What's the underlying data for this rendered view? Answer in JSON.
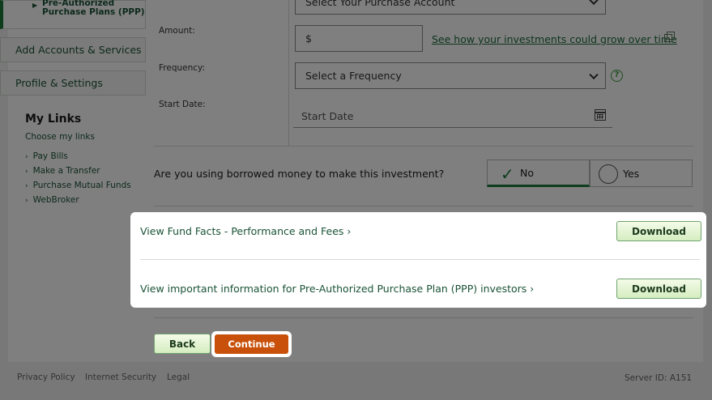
{
  "sidebar": {
    "ppp_item_line1": "Pre-Authorized",
    "ppp_item_line2": "Purchase Plans (PPP)",
    "add_accounts": "Add Accounts & Services",
    "profile_settings": "Profile & Settings",
    "my_links_title": "My Links",
    "choose_links": "Choose my links",
    "links": [
      "Pay Bills",
      "Make a Transfer",
      "Purchase Mutual Funds",
      "WebBroker"
    ]
  },
  "form": {
    "account_select": "Select Your Purchase Account",
    "amount_label": "Amount:",
    "amount_prefix": "$",
    "grow_link": "See how your investments could grow over time",
    "frequency_label": "Frequency:",
    "frequency_select": "Select a Frequency",
    "help_glyph": "?",
    "start_date_label": "Start Date:",
    "start_date_placeholder": "Start Date",
    "borrowed_question": "Are you using borrowed money to make this investment?",
    "no_label": "No",
    "yes_label": "Yes",
    "selected_option": "No"
  },
  "documents": {
    "fund_facts_link": "View Fund Facts - Performance and Fees",
    "ppp_info_link": "View important information for Pre-Authorized Purchase Plan (PPP) investors",
    "download_label": "Download"
  },
  "actions": {
    "back": "Back",
    "continue": "Continue"
  },
  "footer": {
    "privacy": "Privacy Policy",
    "security": "Internet Security",
    "legal": "Legal",
    "server_id": "Server ID: A151"
  },
  "colors": {
    "brand_green": "#1a7a3a",
    "continue_orange": "#c8500a"
  }
}
